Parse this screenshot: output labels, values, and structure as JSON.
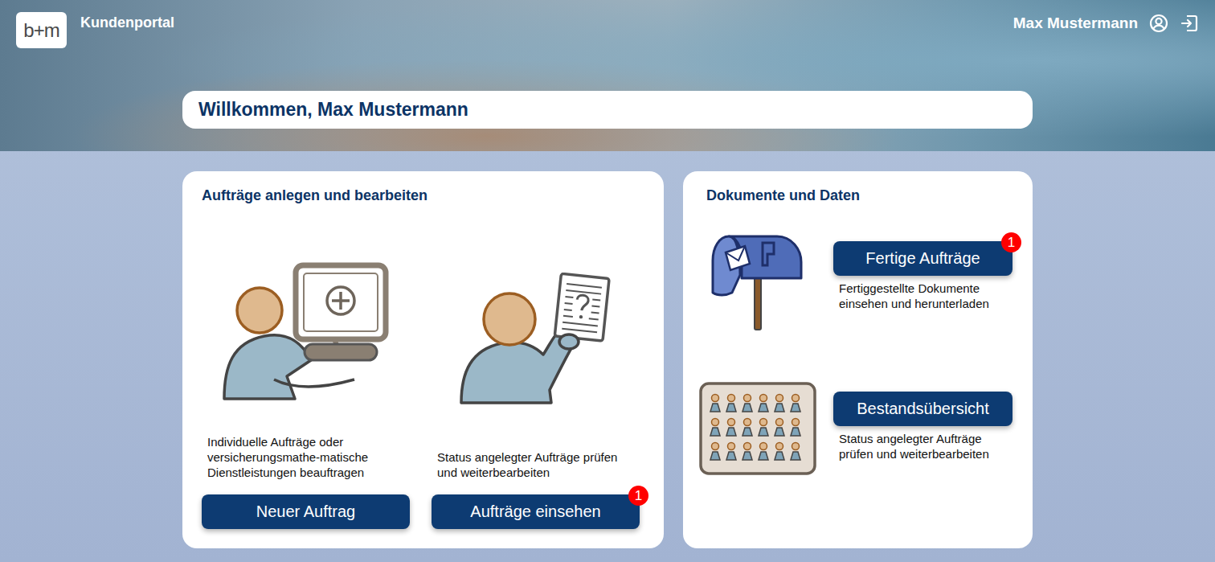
{
  "header": {
    "logo": "b+m",
    "title": "Kundenportal",
    "user": "Max Mustermann"
  },
  "welcome": "Willkommen, Max Mustermann",
  "orders": {
    "title": "Aufträge anlegen und bearbeiten",
    "actions": [
      {
        "kind": "new",
        "description": "Individuelle Aufträge oder versicherungsmathe-matische Dienstleistungen beauftragen",
        "button": "Neuer Auftrag"
      },
      {
        "kind": "view",
        "description": "Status angelegter Aufträge prüfen und weiterbearbeiten",
        "button": "Aufträge einsehen",
        "badge": "1"
      }
    ]
  },
  "documents": {
    "title": "Dokumente und Daten",
    "items": [
      {
        "kind": "mailbox",
        "button": "Fertige Aufträge",
        "badge": "1",
        "description": "Fertiggestellte Dokumente einsehen und herunterladen"
      },
      {
        "kind": "inventory",
        "button": "Bestandsübersicht",
        "description": "Status angelegter Aufträge prüfen und weiterbearbeiten"
      }
    ]
  }
}
